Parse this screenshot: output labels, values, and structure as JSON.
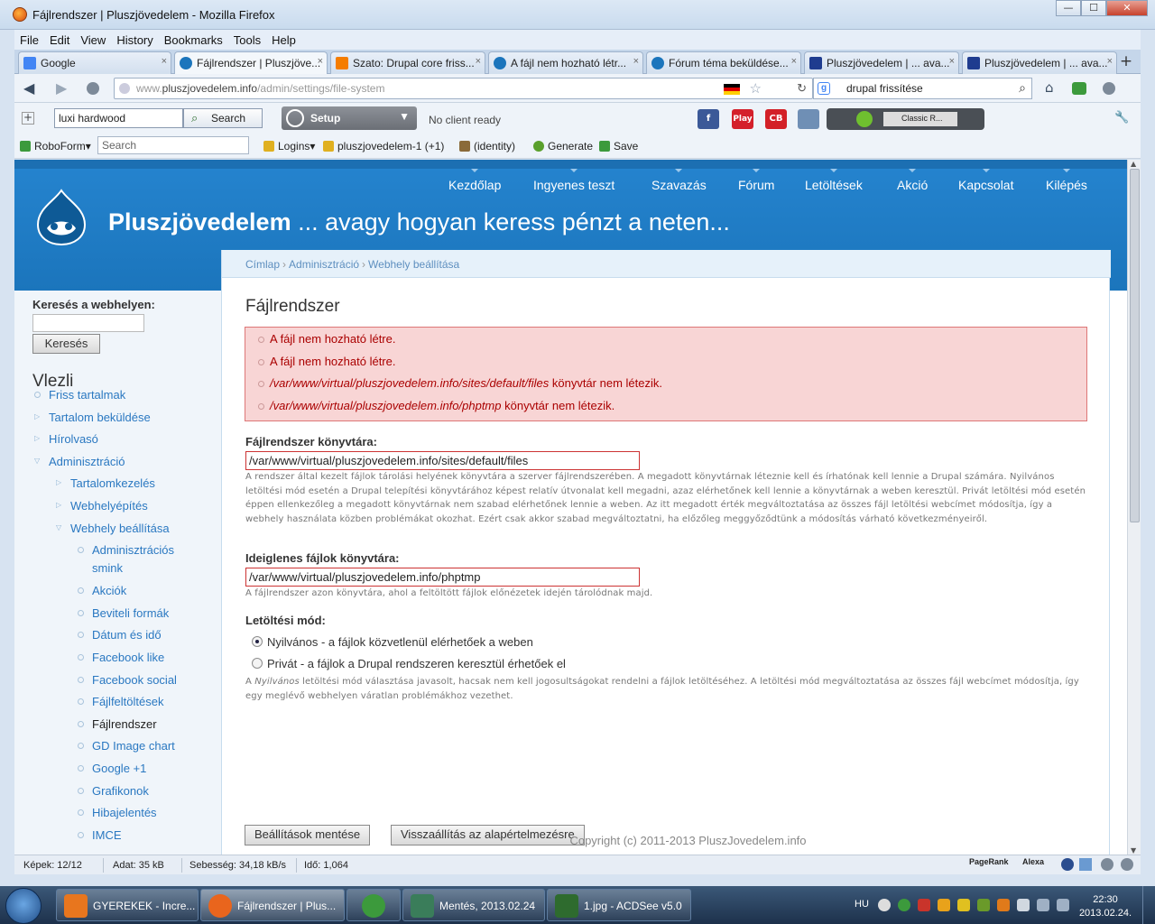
{
  "window": {
    "title": "Fájlrendszer | Pluszjövedelem - Mozilla Firefox",
    "minimize": "—",
    "maximize": "☐",
    "close": "✕"
  },
  "menu": [
    "File",
    "Edit",
    "View",
    "History",
    "Bookmarks",
    "Tools",
    "Help"
  ],
  "tabs": [
    {
      "label": "Google",
      "icon": "google-icon",
      "color": "#4285f4"
    },
    {
      "label": "Fájlrendszer | Pluszjöve...",
      "icon": "drupal-icon",
      "color": "#1b75bc",
      "active": true
    },
    {
      "label": "Szato: Drupal core friss...",
      "icon": "blogger-icon",
      "color": "#f57d00"
    },
    {
      "label": "A fájl nem hozható létr...",
      "icon": "drupal-icon",
      "color": "#1b75bc"
    },
    {
      "label": "Fórum téma beküldése...",
      "icon": "drupal-icon",
      "color": "#1b75bc"
    },
    {
      "label": "Pluszjövedelem | ... ava...",
      "icon": "site-icon",
      "color": "#1f3c8f"
    },
    {
      "label": "Pluszjövedelem | ... ava...",
      "icon": "site-icon",
      "color": "#1f3c8f"
    }
  ],
  "new_tab": "+",
  "close_tab": "×",
  "nav": {
    "back": "◀",
    "forward": "▶",
    "reload": "↻",
    "url_host": "www.",
    "url_main": "pluszjovedelem.info",
    "url_path": "/admin/settings/file-system",
    "star": "☆",
    "search_engine": "g",
    "search_value": "drupal frissítése",
    "search_icon": "⌕",
    "home": "⌂"
  },
  "toolbar2": {
    "plus": "+",
    "search_value": "luxi hardwood",
    "search_button": "Search",
    "setup_label": "Setup",
    "status": "No client ready",
    "badges": [
      {
        "label": "f",
        "color": "#3b5998"
      },
      {
        "label": "Play",
        "color": "#d4202b"
      },
      {
        "label": "CB",
        "color": "#d32027"
      }
    ],
    "player_station": "Classic R...",
    "wrench": "🔧"
  },
  "toolbar3": {
    "roboform": "RoboForm",
    "search_placeholder": "Search",
    "logins": "Logins",
    "bookmark": "pluszjovedelem-1 (+1)",
    "identity": "(identity)",
    "generate": "Generate",
    "save": "Save"
  },
  "site": {
    "name_bold": "Pluszjövedelem",
    "slogan": " ... avagy hogyan keress pénzt a neten...",
    "primary_nav": [
      "Kezdőlap",
      "Ingyenes teszt",
      "Szavazás",
      "Fórum",
      "Letöltések",
      "Akció",
      "Kapcsolat",
      "Kilépés"
    ],
    "breadcrumb": [
      "Címlap",
      "Adminisztráció",
      "Webhely beállítása"
    ],
    "breadcrumb_sep": "›",
    "footer": "Copyright (c) 2011-2013 PluszJovedelem.info"
  },
  "sidebar": {
    "search_label": "Keresés a webhelyen:",
    "search_button": "Keresés",
    "title": "Vlezli",
    "items": [
      {
        "label": "Friss tartalmak",
        "level": 0,
        "marker": "bullet"
      },
      {
        "label": "Tartalom beküldése",
        "level": 0,
        "marker": "closed"
      },
      {
        "label": "Hírolvasó",
        "level": 0,
        "marker": "closed"
      },
      {
        "label": "Adminisztráció",
        "level": 0,
        "marker": "open"
      },
      {
        "label": "Tartalomkezelés",
        "level": 1,
        "marker": "closed"
      },
      {
        "label": "Webhelyépítés",
        "level": 1,
        "marker": "closed"
      },
      {
        "label": "Webhely beállítása",
        "level": 1,
        "marker": "open"
      },
      {
        "label": "Adminisztrációs",
        "label2": "smink",
        "level": 2,
        "marker": "bullet"
      },
      {
        "label": "Akciók",
        "level": 2,
        "marker": "bullet"
      },
      {
        "label": "Beviteli formák",
        "level": 2,
        "marker": "bullet"
      },
      {
        "label": "Dátum és idő",
        "level": 2,
        "marker": "bullet"
      },
      {
        "label": "Facebook like",
        "level": 2,
        "marker": "bullet"
      },
      {
        "label": "Facebook social",
        "level": 2,
        "marker": "bullet"
      },
      {
        "label": "Fájlfeltöltések",
        "level": 2,
        "marker": "bullet"
      },
      {
        "label": "Fájlrendszer",
        "level": 2,
        "marker": "bullet",
        "active": true
      },
      {
        "label": "GD Image chart",
        "level": 2,
        "marker": "bullet"
      },
      {
        "label": "Google +1",
        "level": 2,
        "marker": "bullet"
      },
      {
        "label": "Grafikonok",
        "level": 2,
        "marker": "bullet"
      },
      {
        "label": "Hibajelentés",
        "level": 2,
        "marker": "bullet"
      },
      {
        "label": "IMCE",
        "level": 2,
        "marker": "bullet"
      }
    ]
  },
  "main": {
    "title": "Fájlrendszer",
    "errors": [
      {
        "italic": "",
        "text": "A fájl nem hozható létre."
      },
      {
        "italic": "",
        "text": "A fájl nem hozható létre."
      },
      {
        "italic": "/var/www/virtual/pluszjovedelem.info/sites/default/files",
        "text": " könyvtár nem létezik."
      },
      {
        "italic": "/var/www/virtual/pluszjovedelem.info/phptmp",
        "text": " könyvtár nem létezik."
      }
    ],
    "file_system_label": "Fájlrendszer könyvtára:",
    "file_system_value": "/var/www/virtual/pluszjovedelem.info/sites/default/files",
    "file_system_desc": "A rendszer által kezelt fájlok tárolási helyének könyvtára a szerver fájlrendszerében. A megadott könyvtárnak léteznie kell és írhatónak kell lennie a Drupal számára. Nyilvános letöltési mód esetén a Drupal telepítési könyvtárához képest relatív útvonalat kell megadni, azaz elérhetőnek kell lennie a könyvtárnak a weben keresztül. Privát letöltési mód esetén éppen ellenkezőleg a megadott könyvtárnak nem szabad elérhetőnek lennie a weben. Az itt megadott érték megváltoztatása az összes fájl letöltési webcímet módosítja, így a webhely használata közben problémákat okozhat. Ezért csak akkor szabad megváltoztatni, ha előzőleg meggyőződtünk a módosítás várható következményeiről.",
    "temp_label": "Ideiglenes fájlok könyvtára:",
    "temp_value": "/var/www/virtual/pluszjovedelem.info/phptmp",
    "temp_desc": "A fájlrendszer azon könyvtára, ahol a feltöltött fájlok előnézetek idején tárolódnak majd.",
    "download_label": "Letöltési mód:",
    "download_options": [
      {
        "label": "Nyilvános - a fájlok közvetlenül elérhetőek a weben",
        "checked": true
      },
      {
        "label": "Privát - a fájlok a Drupal rendszeren keresztül érhetőek el",
        "checked": false
      }
    ],
    "download_desc_pre": "A ",
    "download_desc_em": "Nyilvános",
    "download_desc_post": " letöltési mód választása javasolt, hacsak nem kell jogosultságokat rendelni a fájlok letöltéséhez. A letöltési mód megváltoztatása az összes fájl webcímet módosítja, így egy meglévő webhelyen váratlan problémákhoz vezethet.",
    "save_button": "Beállítások mentése",
    "reset_button": "Visszaállítás az alapértelmezésre"
  },
  "statusbar": {
    "images": "Képek: 12/12",
    "data": "Adat: 35 kB",
    "speed": "Sebesség: 34,18 kB/s",
    "time": "Idő: 1,064",
    "pagerank": "PageRank",
    "alexa": "Alexa"
  },
  "taskbar": {
    "tasks": [
      {
        "label": "GYEREKEK - Incre...",
        "color": "#e8761e"
      },
      {
        "label": "Fájlrendszer | Plus...",
        "color": "#e9651d",
        "active": true
      },
      {
        "label": "",
        "color": "#3c9a3c"
      },
      {
        "label": "Mentés, 2013.02.24",
        "color": "#3a7d5a"
      },
      {
        "label": "1.jpg - ACDSee v5.0",
        "color": "#2e6b2e"
      }
    ],
    "lang": "HU",
    "time": "22:30",
    "date": "2013.02.24."
  }
}
